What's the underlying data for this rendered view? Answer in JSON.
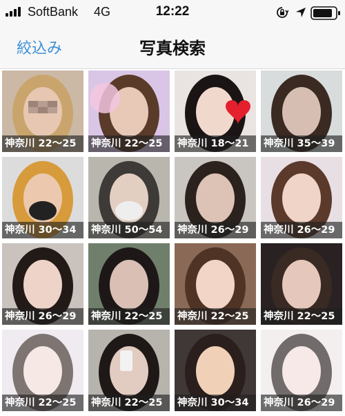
{
  "status_bar": {
    "carrier": "SoftBank",
    "network": "4G",
    "time": "12:22",
    "icons": [
      "signal-icon",
      "rotation-lock-icon",
      "location-arrow-icon",
      "battery-icon"
    ]
  },
  "nav": {
    "filter_label": "絞込み",
    "title": "写真検索"
  },
  "accent_color": "#3b8fd6",
  "grid": {
    "items": [
      {
        "caption": "神奈川 22〜25",
        "bg": "#cbb9a6",
        "hair": "#c9a56d",
        "skin": "#e7c7b2",
        "blur": "pixelated-eyes"
      },
      {
        "caption": "神奈川 22〜25",
        "bg": "#d9c6e6",
        "hair": "#5a3b2a",
        "skin": "#e8c9b8",
        "blur": "sparkle-sticker"
      },
      {
        "caption": "神奈川 18〜21",
        "bg": "#e9e4e2",
        "hair": "#1a1414",
        "skin": "#f1d8cd",
        "blur": "heart-sticker"
      },
      {
        "caption": "神奈川 35〜39",
        "bg": "#d8dcdc",
        "hair": "#3a2a22",
        "skin": "#d6bfb2",
        "blur": "none"
      },
      {
        "caption": "神奈川 30〜34",
        "bg": "#dcdcdc",
        "hair": "#d79b3c",
        "skin": "#ecc9ae",
        "blur": "mask"
      },
      {
        "caption": "神奈川 50〜54",
        "bg": "#b9b6ae",
        "hair": "#3e3a37",
        "skin": "#e3cfc2",
        "blur": "mask"
      },
      {
        "caption": "神奈川 26〜29",
        "bg": "#c9c5c0",
        "hair": "#2c221d",
        "skin": "#dcc3b6",
        "blur": "none"
      },
      {
        "caption": "神奈川 26〜29",
        "bg": "#e8dfe4",
        "hair": "#5b3a2c",
        "skin": "#f0d4c8",
        "blur": "none"
      },
      {
        "caption": "神奈川 26〜29",
        "bg": "#c9c2bd",
        "hair": "#221a17",
        "skin": "#eed3c8",
        "blur": "none"
      },
      {
        "caption": "神奈川 22〜25",
        "bg": "#6f7f6c",
        "hair": "#1d1817",
        "skin": "#d9bfb4",
        "blur": "none"
      },
      {
        "caption": "神奈川 22〜25",
        "bg": "#8a6a56",
        "hair": "#4f3426",
        "skin": "#f2d5c7",
        "blur": "none"
      },
      {
        "caption": "神奈川 22〜25",
        "bg": "#2a2222",
        "hair": "#3a2a24",
        "skin": "#e5c7bb",
        "blur": "none"
      },
      {
        "caption": "神奈川 22〜25",
        "bg": "#e6e1ea",
        "hair": "#3a2a26",
        "skin": "#f1dcd8",
        "blur": "soft"
      },
      {
        "caption": "神奈川 22〜25",
        "bg": "#b7b4ae",
        "hair": "#1e1817",
        "skin": "#e2cbc0",
        "blur": "phone"
      },
      {
        "caption": "神奈川 30〜34",
        "bg": "#3f3836",
        "hair": "#2a1f1c",
        "skin": "#f1d0b8",
        "blur": "none"
      },
      {
        "caption": "神奈川 26〜29",
        "bg": "#ece7e5",
        "hair": "#261e1c",
        "skin": "#f2dedb",
        "blur": "soft"
      }
    ]
  }
}
